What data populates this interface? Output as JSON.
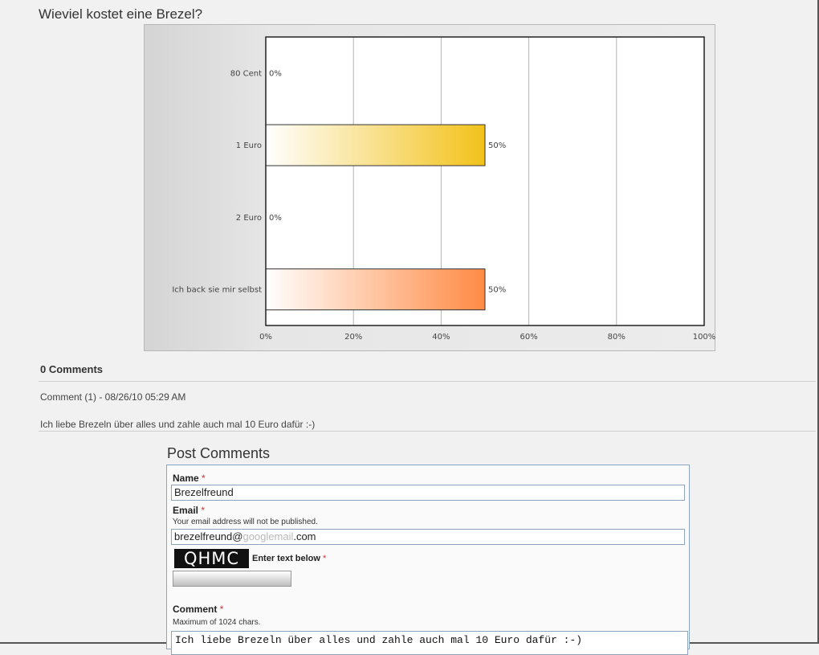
{
  "page": {
    "title": "Wieviel kostet eine Brezel?"
  },
  "chart_data": {
    "type": "bar",
    "orientation": "horizontal",
    "categories": [
      "80 Cent",
      "1 Euro",
      "2 Euro",
      "Ich back sie mir selbst"
    ],
    "values": [
      0,
      50,
      0,
      50
    ],
    "value_labels": [
      "0%",
      "50%",
      "0%",
      "50%"
    ],
    "bar_colors": [
      "#f2c21a",
      "#f2c21a",
      "#ff8a44",
      "#ff8a44"
    ],
    "xlim": [
      0,
      100
    ],
    "x_ticks": [
      "0%",
      "20%",
      "40%",
      "60%",
      "80%",
      "100%"
    ],
    "grid": true
  },
  "comments": {
    "count_label": "0 Comments",
    "items": [
      {
        "meta": "Comment (1) - 08/26/10 05:29 AM",
        "text": "Ich liebe Brezeln über alles und zahle auch mal 10 Euro dafür :-)"
      }
    ]
  },
  "form": {
    "title": "Post Comments",
    "name_label": "Name",
    "required_mark": "*",
    "name_value": "Brezelfreund",
    "email_label": "Email",
    "email_hint": "Your email address will not be published.",
    "email_value_start": "brezelfreund@",
    "email_value_blurred": "googlemail",
    "email_value_end": ".com",
    "captcha_text": "QHMC",
    "captcha_label": "Enter text below",
    "comment_label": "Comment",
    "comment_hint": "Maximum of 1024 chars.",
    "comment_value": "Ich liebe Brezeln über alles und zahle auch mal 10 Euro dafür :-)"
  }
}
